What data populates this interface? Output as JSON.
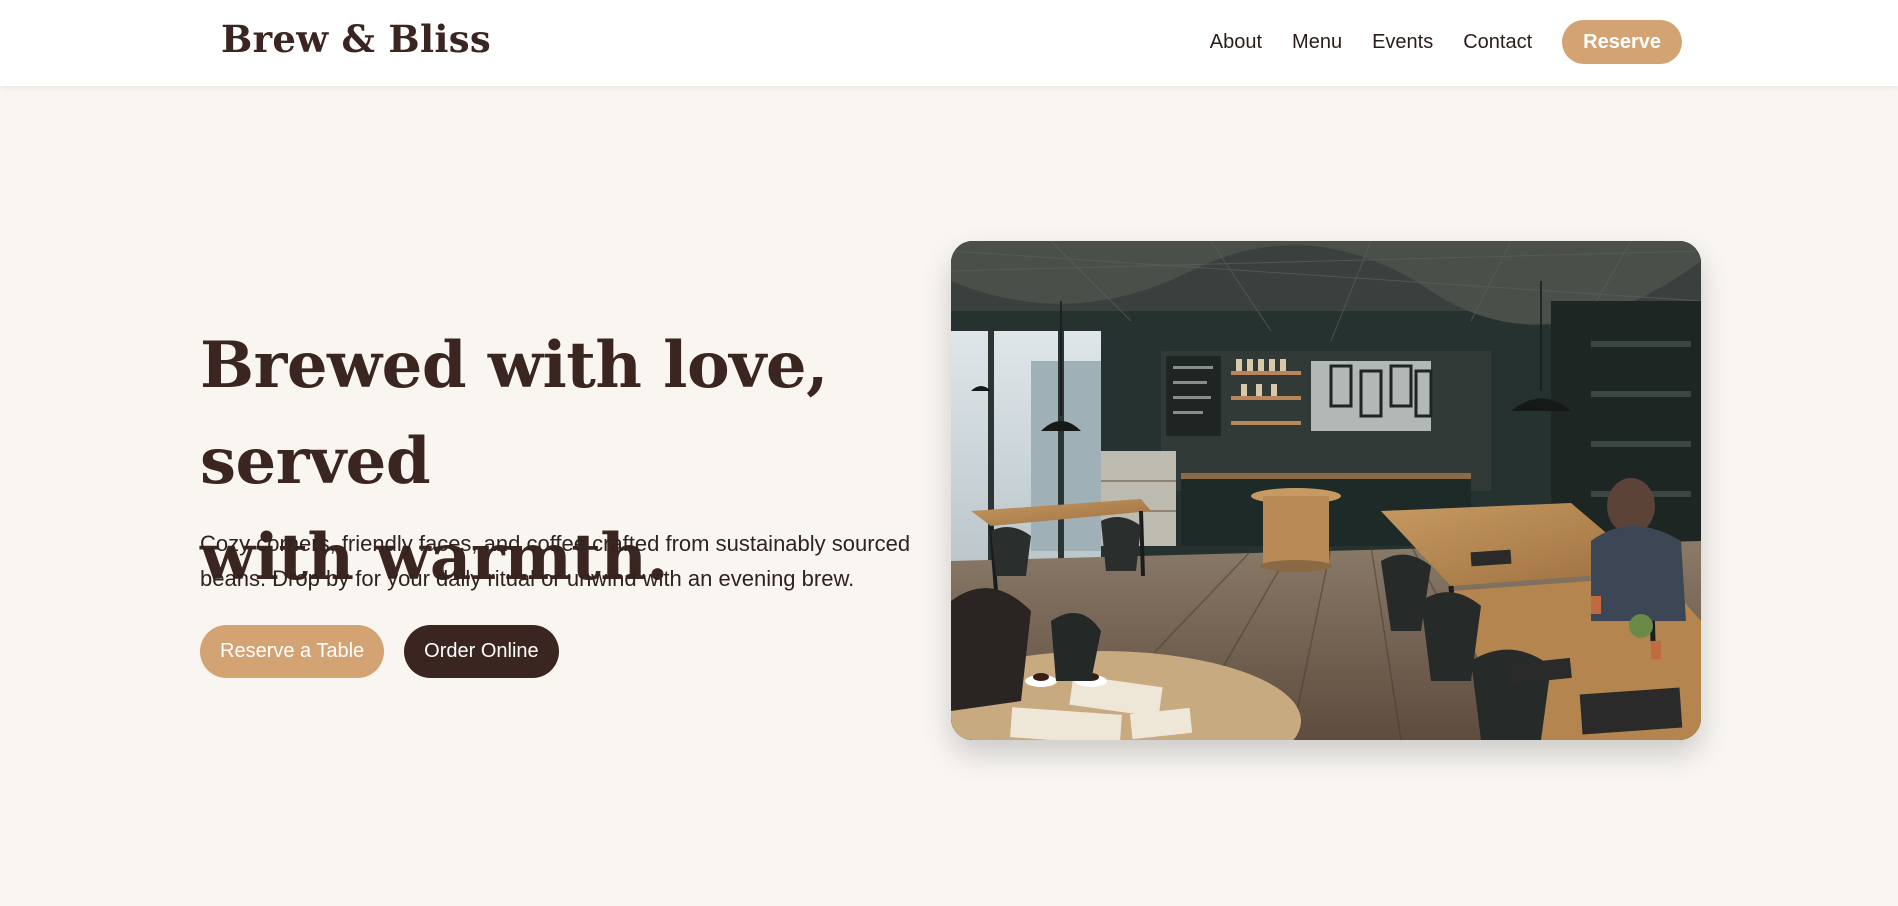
{
  "brand": {
    "name": "Brew & Bliss"
  },
  "nav": {
    "links": [
      "About",
      "Menu",
      "Events",
      "Contact"
    ],
    "cta": "Reserve"
  },
  "hero": {
    "title_line1": "Brewed with love, served",
    "title_line2": "with warmth.",
    "description": "Cozy corners, friendly faces, and coffee crafted from sustainably sourced beans. Drop by for your daily ritual or unwind with an evening brew.",
    "primary_button": "Reserve a Table",
    "secondary_button": "Order Online"
  },
  "colors": {
    "accent": "#d4a373",
    "dark": "#3b2520",
    "background": "#f9f6f2",
    "header": "#ffffff"
  }
}
